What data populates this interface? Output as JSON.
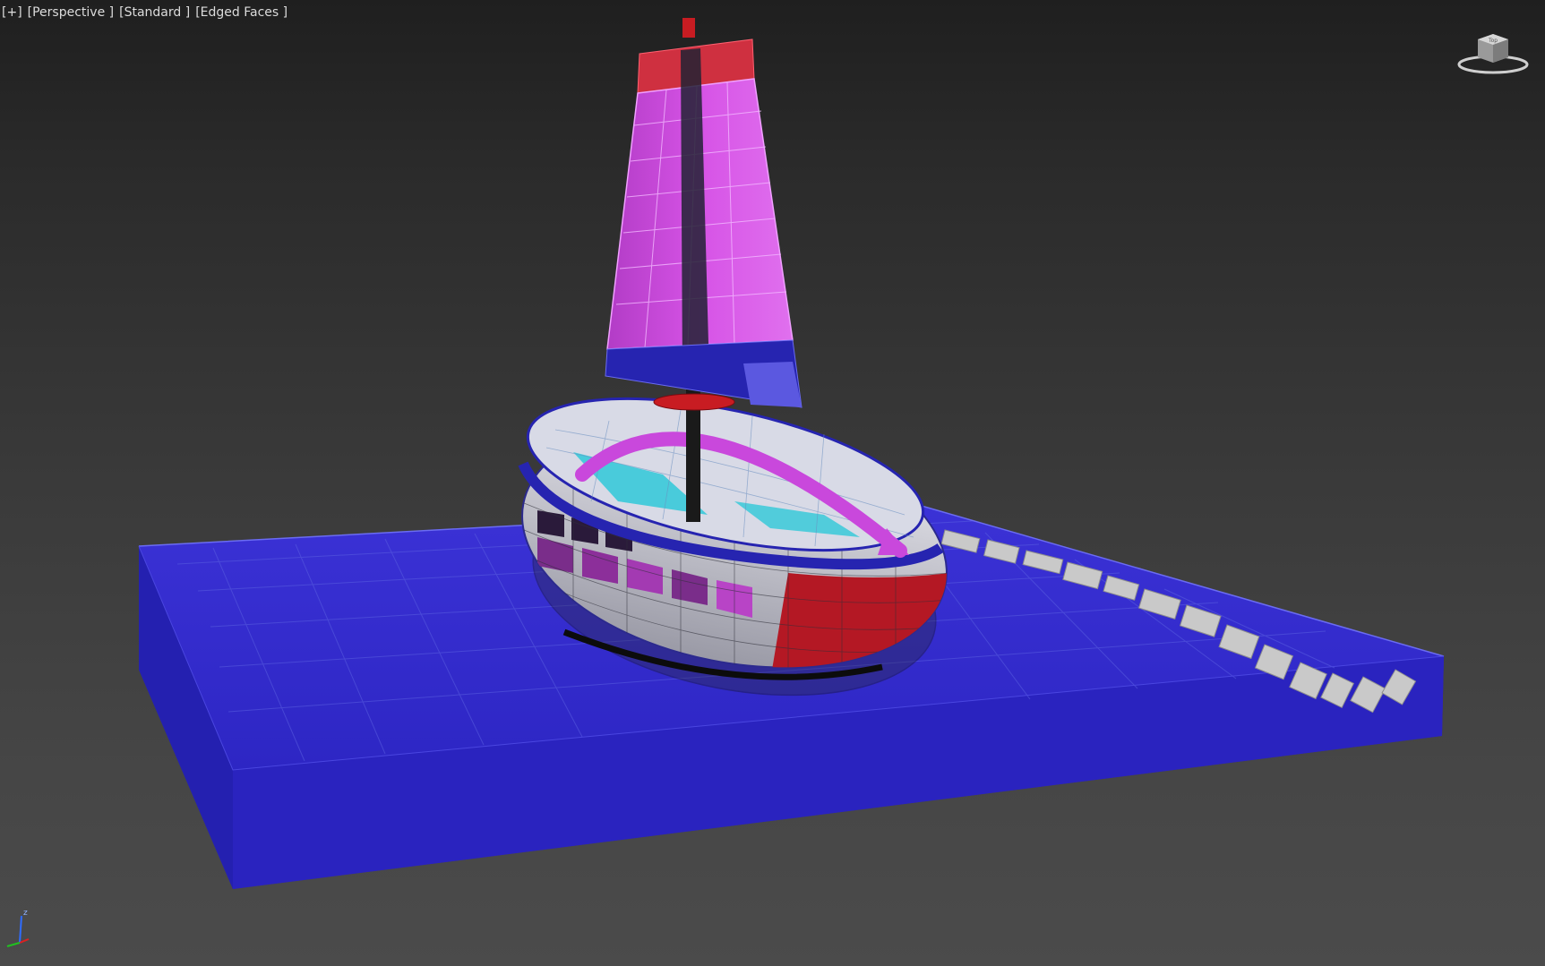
{
  "viewport": {
    "labels": [
      "[+]",
      "[Perspective ]",
      "[Standard ]",
      "[Edged Faces ]"
    ],
    "view_type": "Perspective",
    "shading": "Standard",
    "display_mode": "Edged Faces"
  },
  "viewcube": {
    "icon": "viewcube-icon",
    "face_label": "Top"
  },
  "axis_tripod": {
    "icon": "axis-tripod-icon",
    "axes": [
      "x",
      "y",
      "z"
    ],
    "z_label": "z"
  },
  "scene": {
    "objects": [
      {
        "name": "water-plane-box",
        "color": "#2a22c8"
      },
      {
        "name": "boat-hull",
        "color": "#d8d8e0"
      },
      {
        "name": "mast",
        "color": "#1a1a1a"
      },
      {
        "name": "sail",
        "color": "#d24ce0"
      },
      {
        "name": "wake-text-trail",
        "color": "#c9c9c9"
      }
    ],
    "colors": {
      "background_top": "#1f1f1f",
      "background_bottom": "#4b4b4b",
      "box_blue": "#2a22c8",
      "hull_red": "#b41824",
      "sail_magenta": "#d24ce0",
      "band_blue": "#2624b0",
      "deck_cyan": "#30c8d8"
    }
  }
}
